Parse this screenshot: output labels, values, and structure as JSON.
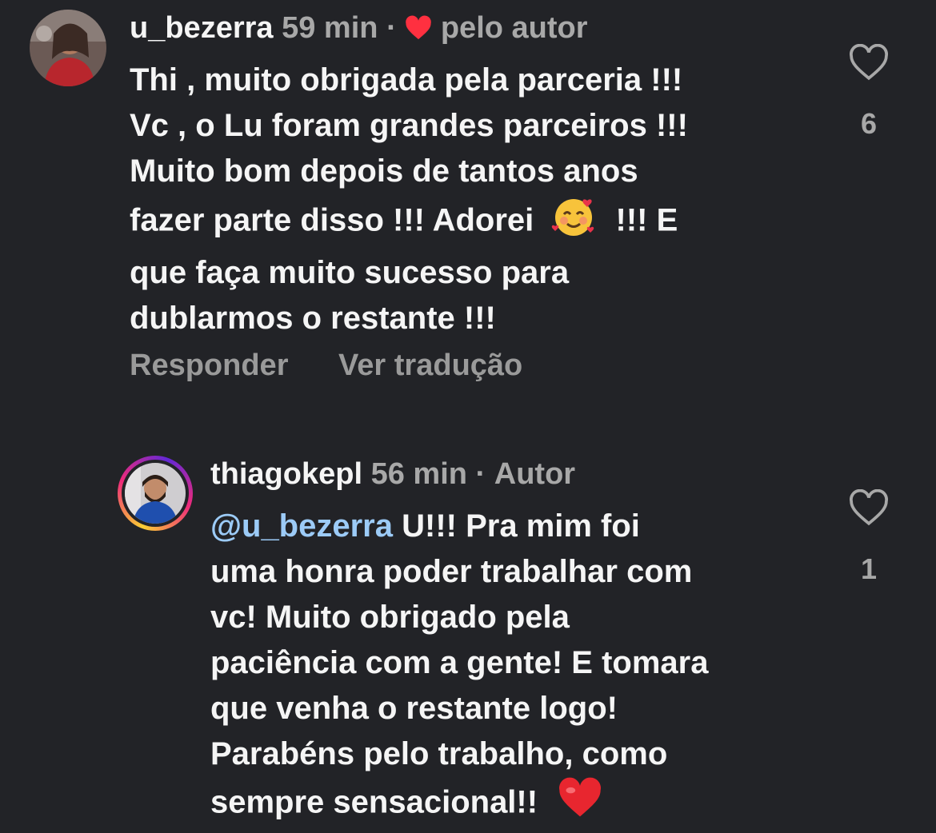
{
  "comments": [
    {
      "username": "u_bezerra",
      "time": "59 min",
      "separator": "·",
      "author_like_label": "pelo autor",
      "lines": [
        "Thi , muito obrigada pela parceria !!!",
        "Vc , o Lu foram grandes parceiros !!!",
        "Muito bom depois de tantos anos",
        "fazer parte disso !!! Adorei",
        "!!! E",
        "que faça muito sucesso para",
        "dublarmos o restante !!!"
      ],
      "likes": "6",
      "reply_label": "Responder",
      "translate_label": "Ver tradução"
    },
    {
      "username": "thiagokepl",
      "time": "56 min",
      "separator": "·",
      "author_badge": "Autor",
      "mention": "@u_bezerra",
      "lines": [
        "U!!! Pra mim foi",
        "uma honra poder trabalhar com",
        "vc! Muito obrigado pela",
        "paciência com a gente! E tomara",
        "que venha o restante logo!",
        "Parabéns pelo trabalho, como",
        "sempre sensacional!!"
      ],
      "likes": "1"
    }
  ],
  "colors": {
    "background": "#222327",
    "text": "#f5f5f5",
    "meta": "#a8a8a8",
    "mention": "#9ccbf7",
    "heart": "#ff3040"
  },
  "icons": [
    "heart-icon",
    "smiling-face-with-hearts-emoji",
    "red-heart-emoji"
  ]
}
